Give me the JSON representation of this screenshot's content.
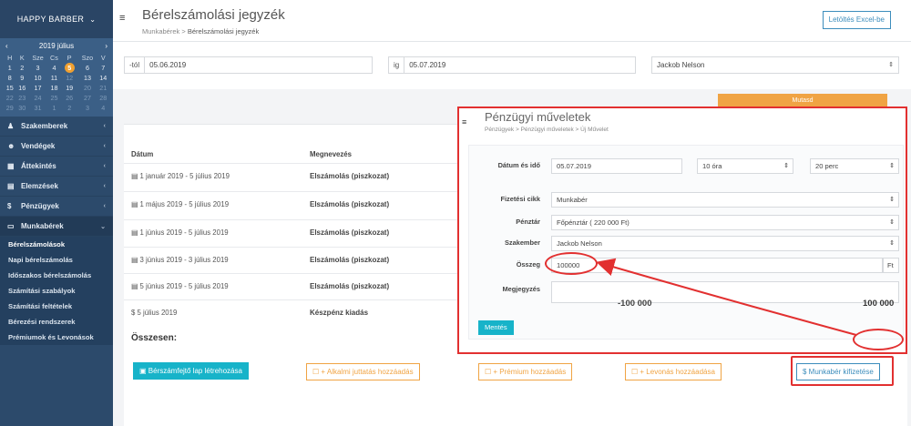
{
  "sidebar": {
    "brand": "HAPPY BARBER",
    "calendar": {
      "month": "2019 július",
      "prev": "‹",
      "next": "›",
      "dow": [
        "H",
        "K",
        "Sze",
        "Cs",
        "P",
        "Szo",
        "V"
      ],
      "weeks": [
        [
          "1",
          "2",
          "3",
          "4",
          "5",
          "6",
          "7"
        ],
        [
          "8",
          "9",
          "10",
          "11",
          "12",
          "13",
          "14"
        ],
        [
          "15",
          "16",
          "17",
          "18",
          "19",
          "20",
          "21"
        ],
        [
          "22",
          "23",
          "24",
          "25",
          "26",
          "27",
          "28"
        ],
        [
          "29",
          "30",
          "31",
          "1",
          "2",
          "3",
          "4"
        ]
      ]
    },
    "nav": [
      {
        "label": "Szakemberek",
        "icon": "user-icon"
      },
      {
        "label": "Vendégek",
        "icon": "users-icon"
      },
      {
        "label": "Áttekintés",
        "icon": "grid-icon"
      },
      {
        "label": "Elemzések",
        "icon": "chart-icon"
      },
      {
        "label": "Pénzügyek",
        "icon": "dollar-icon"
      },
      {
        "label": "Munkabérek",
        "icon": "money-icon"
      }
    ],
    "sub": [
      "Bérelszámolások",
      "Napi bérelszámolás",
      "Időszakos bérelszámolás",
      "Számítási szabályok",
      "Számítási feltételek",
      "Bérezési rendszerek",
      "Prémiumok és Levonások"
    ]
  },
  "header": {
    "title": "Bérelszámolási jegyzék",
    "crumb_parent": "Munkabérek",
    "crumb_sep": ">",
    "crumb_current": "Bérelszámolási jegyzék",
    "excel_button": "Letöltés Excel-be"
  },
  "filters": {
    "from_prefix": "-tól",
    "from_value": "05.06.2019",
    "to_prefix": "ig",
    "to_value": "05.07.2019",
    "employee": "Jackob Nelson",
    "show_button": "Mutasd"
  },
  "table": {
    "col_date": "Dátum",
    "col_name": "Megnevezés",
    "rows": [
      {
        "date": "1 január 2019 - 5 július 2019",
        "name": "Elszámolás (piszkozat)"
      },
      {
        "date": "1 május 2019 - 5 július 2019",
        "name": "Elszámolás (piszkozat)"
      },
      {
        "date": "1 június 2019 - 5 július 2019",
        "name": "Elszámolás (piszkozat)"
      },
      {
        "date": "3 június 2019 - 3 július 2019",
        "name": "Elszámolás (piszkozat)"
      },
      {
        "date": "5 június 2019 - 5 július 2019",
        "name": "Elszámolás (piszkozat)"
      },
      {
        "date": "5 július 2019",
        "name": "Készpénz kiadás"
      }
    ],
    "total_label": "Összesen:"
  },
  "actions": {
    "payslip": "Bérszámfejtő lap létrehozása",
    "bonus_once": "+ Alkalmi juttatás hozzáadás",
    "premium": "+ Prémium hozzáadás",
    "deduction": "+ Levonás hozzáadása",
    "pay": "$ Munkabér kifizetése"
  },
  "modal": {
    "title": "Pénzügyi műveletek",
    "crumb": "Pénzügyek > Pénzügyi műveletek > Új Művelet",
    "datetime_label": "Dátum és idő",
    "date_value": "05.07.2019",
    "hour_value": "10 óra",
    "minute_value": "20 perc",
    "item_label": "Fizetési cikk",
    "item_value": "Munkabér",
    "cashdesk_label": "Pénztár",
    "cashdesk_value": "Főpénztár ( 220 000 Ft)",
    "specialist_label": "Szakember",
    "specialist_value": "Jackob Nelson",
    "amount_label": "Összeg",
    "amount_value": "100000",
    "currency": "Ft",
    "note_label": "Megjegyzés",
    "save_button": "Mentés",
    "sum_negative": "-100 000",
    "sum_positive": "100 000"
  },
  "colors": {
    "sidebar": "#2c4a6b",
    "accent_cyan": "#17b3c9",
    "accent_orange": "#f0a444",
    "accent_blue": "#3c8dbc",
    "highlight_red": "#e23030"
  }
}
